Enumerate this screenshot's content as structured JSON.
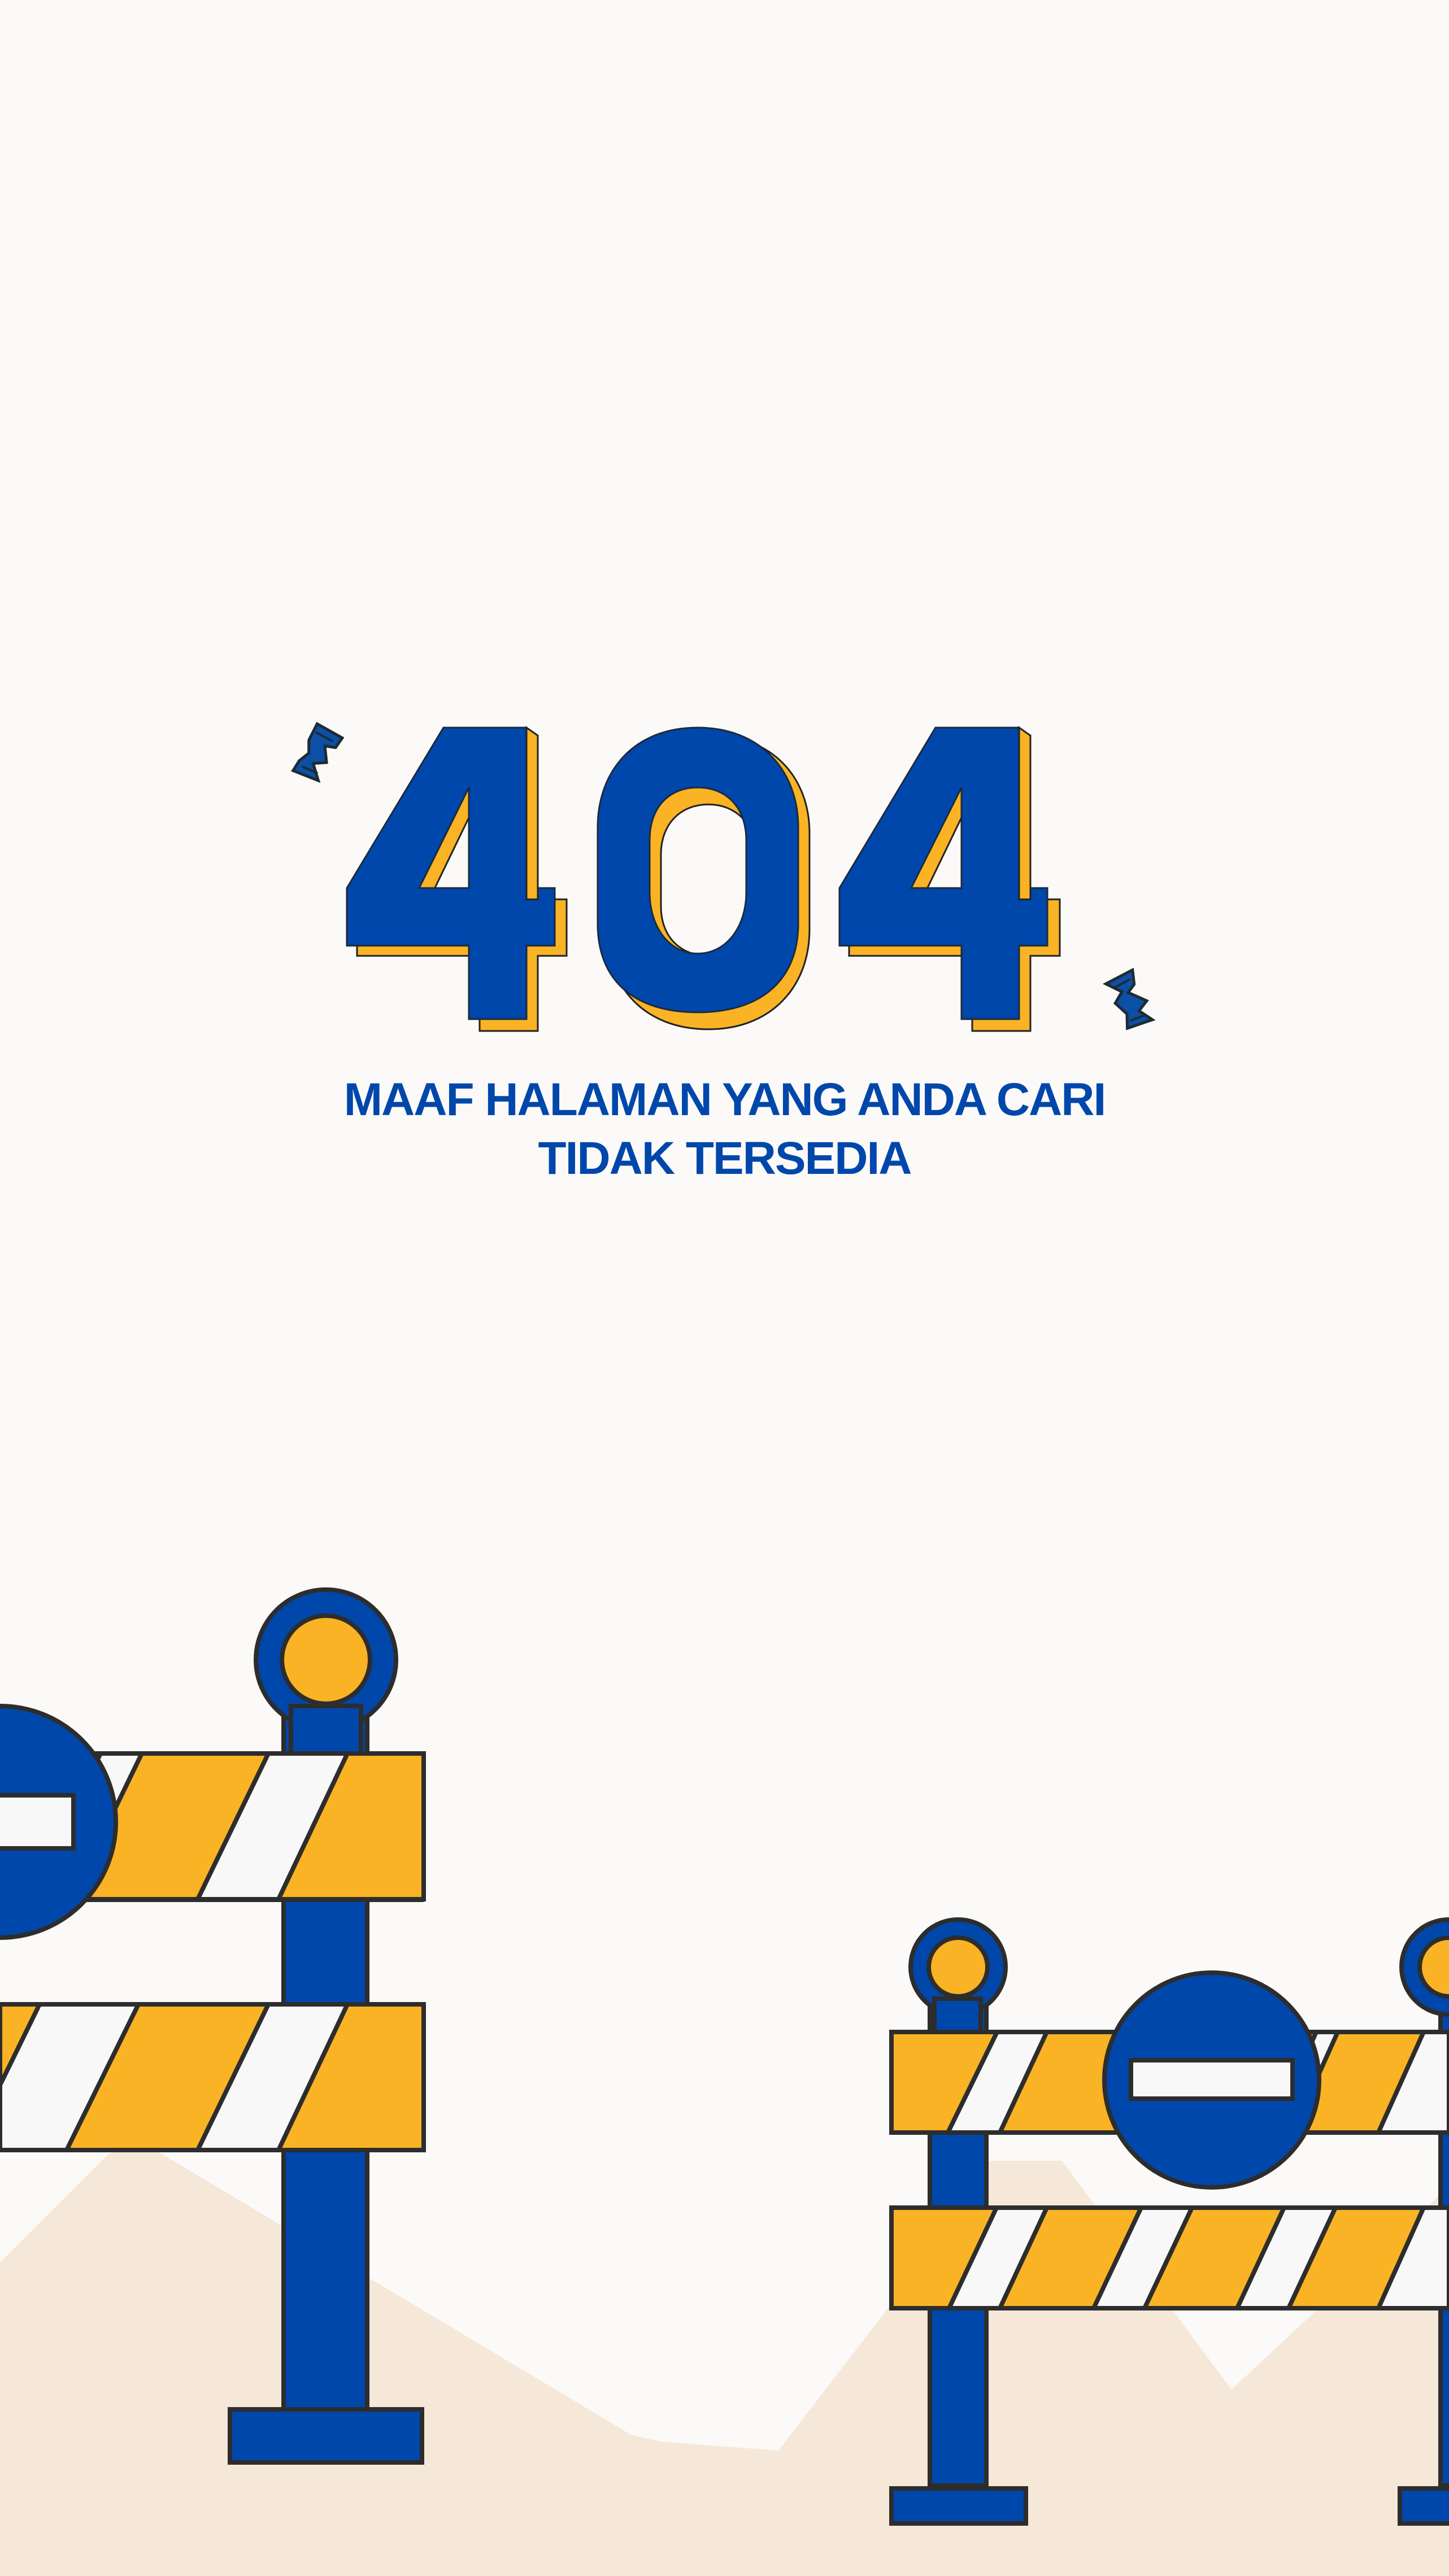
{
  "error": {
    "code": "404",
    "message_line_1": "MAAF HALAMAN YANG ANDA CARI",
    "message_line_2": "TIDAK TERSEDIA"
  },
  "colors": {
    "background": "#fbfaf8",
    "ground": "#f5e8d8",
    "blue": "#0047ab",
    "yellow": "#f9b324",
    "white": "#f8f8f8",
    "outline": "#2d2d2d"
  },
  "icons": {
    "left_pixel_debris": "broken-piece-icon",
    "right_pixel_debris": "broken-piece-icon",
    "barrier": "road-barrier-icon",
    "no_entry_sign": "no-entry-sign-icon"
  }
}
